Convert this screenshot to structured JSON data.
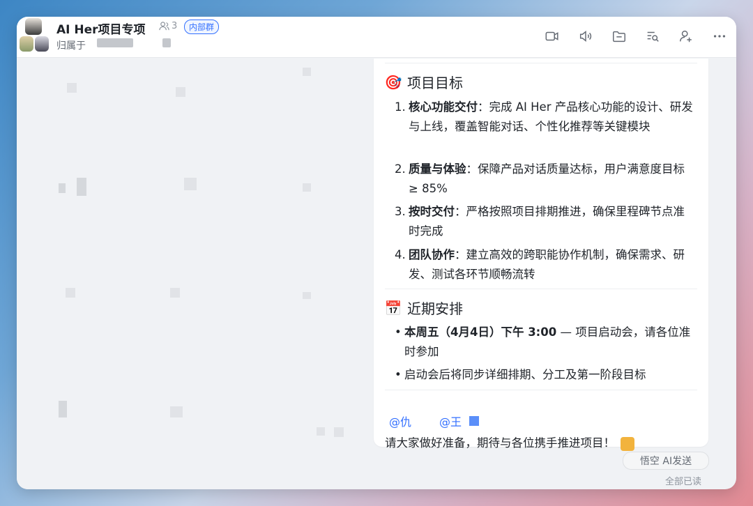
{
  "header": {
    "title": "AI Her项目专项",
    "member_count": "3",
    "badge": "内部群",
    "belongs_label": "归属于",
    "toolbar": [
      {
        "icon": "video-camera-icon"
      },
      {
        "icon": "voice-call-icon"
      },
      {
        "icon": "folder-icon"
      },
      {
        "icon": "search-messages-icon"
      },
      {
        "icon": "add-member-icon"
      },
      {
        "icon": "more-icon"
      }
    ]
  },
  "message": {
    "goals": {
      "emoji": "🎯",
      "title": "项目目标",
      "items": [
        {
          "num": "1.",
          "bold": "核心功能交付",
          "text": "：完成 AI Her 产品核心功能的设计、研发与上线，覆盖智能对话、个性化推荐等关键模块"
        },
        {
          "num": "2.",
          "bold": "质量与体验",
          "text": "：保障产品对话质量达标，用户满意度目标 ≥ 85%"
        },
        {
          "num": "3.",
          "bold": "按时交付",
          "text": "：严格按照项目排期推进，确保里程碑节点准时完成"
        },
        {
          "num": "4.",
          "bold": "团队协作",
          "text": "：建立高效的跨职能协作机制，确保需求、研发、测试各环节顺畅流转"
        }
      ]
    },
    "schedule": {
      "emoji": "📅",
      "title": "近期安排",
      "items": [
        {
          "bold": "本周五（4月4日）下午 3:00",
          "text": " — 项目启动会，请各位准时参加"
        },
        {
          "bold": "",
          "text": "启动会后将同步详细排期、分工及第一阶段目标"
        }
      ]
    },
    "mentions": [
      "@仇",
      "@王"
    ],
    "closing": "请大家做好准备，期待与各位携手推进项目！",
    "closing_emoji": "muscle-emoji"
  },
  "actions": {
    "ai_send": "悟空 AI发送",
    "read_status": "全部已读"
  },
  "colors": {
    "accent": "#3370ff",
    "text": "#1f2329",
    "muted": "#8f959e"
  }
}
